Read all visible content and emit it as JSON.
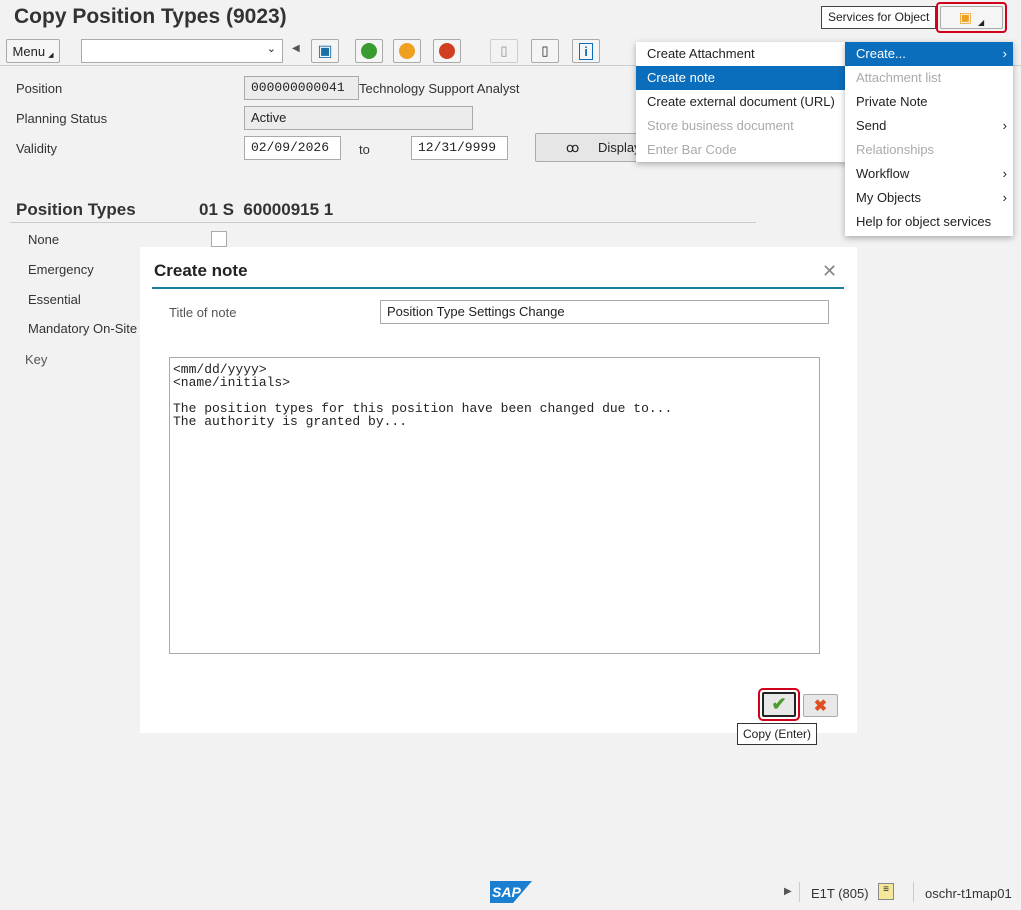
{
  "title": "Copy Position Types (9023)",
  "toolbar": {
    "menu_label": "Menu",
    "services_tooltip": "Services for Object"
  },
  "form": {
    "position_label": "Position",
    "position_id": "000000000041",
    "position_name": "Technology Support Analyst",
    "planning_label": "Planning Status",
    "planning_value": "Active",
    "validity_label": "Validity",
    "valid_from": "02/09/2026",
    "to_label": "to",
    "valid_to": "12/31/9999",
    "display_label": "Display"
  },
  "section": {
    "title": "Position Types",
    "code": "01 S  60000915 1",
    "items": [
      "None",
      "Emergency",
      "Essential",
      "Mandatory On-Site"
    ],
    "key_label": "Key"
  },
  "submenu": [
    {
      "label": "Create Attachment",
      "state": "normal"
    },
    {
      "label": "Create note",
      "state": "selected"
    },
    {
      "label": "Create external document (URL)",
      "state": "normal"
    },
    {
      "label": "Store business document",
      "state": "disabled"
    },
    {
      "label": "Enter Bar Code",
      "state": "disabled"
    }
  ],
  "menu": [
    {
      "label": "Create...",
      "state": "selected",
      "arrow": true
    },
    {
      "label": "Attachment list",
      "state": "disabled"
    },
    {
      "label": "Private Note",
      "state": "normal"
    },
    {
      "label": "Send",
      "state": "normal",
      "arrow": true
    },
    {
      "label": "Relationships",
      "state": "disabled"
    },
    {
      "label": "Workflow",
      "state": "normal",
      "arrow": true
    },
    {
      "label": "My Objects",
      "state": "normal",
      "arrow": true
    },
    {
      "label": "Help for object services",
      "state": "normal"
    }
  ],
  "dialog": {
    "title": "Create note",
    "title_label": "Title of note",
    "title_value": "Position Type Settings Change",
    "body": "<mm/dd/yyyy>\n<name/initials>\n\nThe position types for this position have been changed due to...\nThe authority is granted by...",
    "copy_tooltip": "Copy (Enter)"
  },
  "status": {
    "system": "E1T (805)",
    "server": "oschr-t1map01",
    "logo": "SAP"
  },
  "colors": {
    "accent": "#0a6ebd",
    "highlight": "#d0021b"
  }
}
